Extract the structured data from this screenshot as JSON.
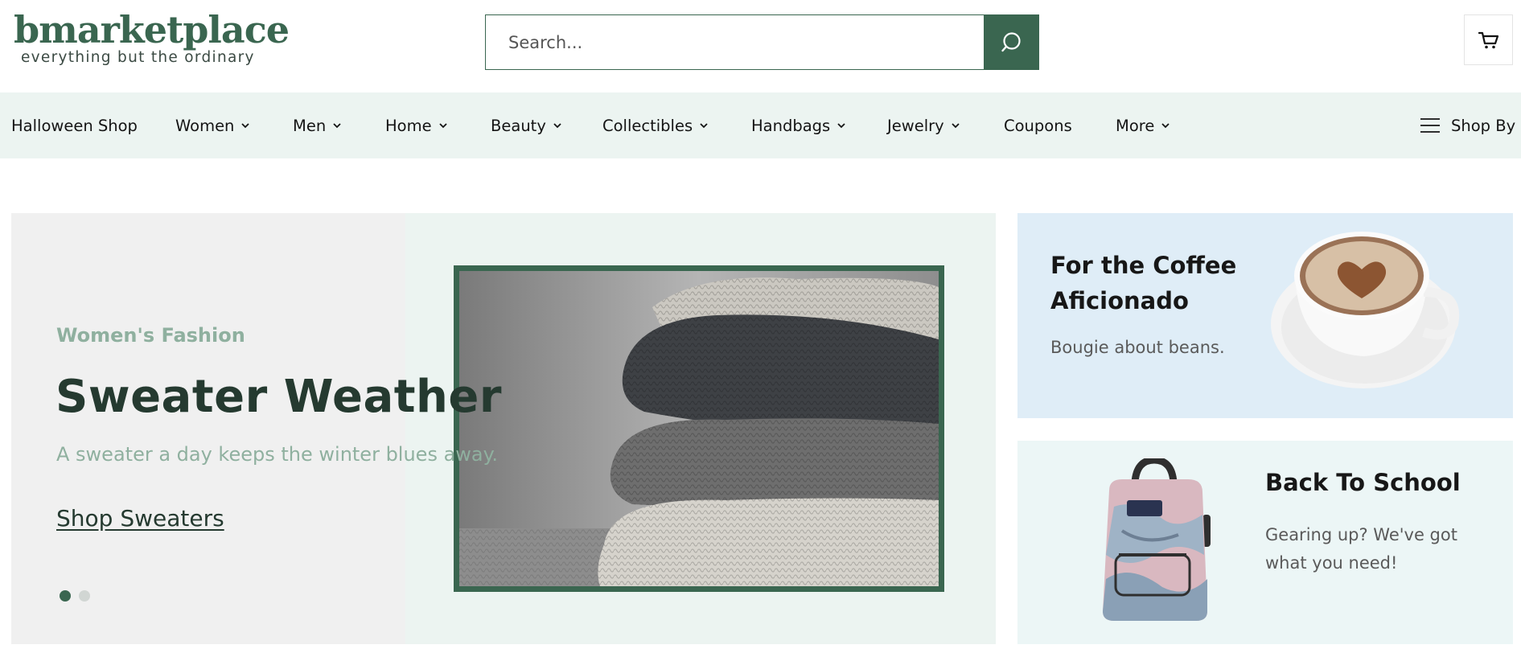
{
  "brand": {
    "name": "bmarketplace",
    "tagline": "everything but the ordinary",
    "accent": "#3a6650"
  },
  "search": {
    "placeholder": "Search...",
    "button_icon": "search-icon"
  },
  "cart": {
    "icon": "cart-icon"
  },
  "nav": {
    "items": [
      {
        "label": "Halloween Shop",
        "dropdown": false
      },
      {
        "label": "Women",
        "dropdown": true
      },
      {
        "label": "Men",
        "dropdown": true
      },
      {
        "label": "Home",
        "dropdown": true
      },
      {
        "label": "Beauty",
        "dropdown": true
      },
      {
        "label": "Collectibles",
        "dropdown": true
      },
      {
        "label": "Handbags",
        "dropdown": true
      },
      {
        "label": "Jewelry",
        "dropdown": true
      },
      {
        "label": "Coupons",
        "dropdown": false
      },
      {
        "label": "More",
        "dropdown": true
      }
    ],
    "shop_by": "Shop By"
  },
  "hero": {
    "kicker": "Women's Fashion",
    "title": "Sweater Weather",
    "subtitle": "A sweater a day keeps the winter blues away.",
    "cta": "Shop Sweaters",
    "slides": 2,
    "active_slide": 1
  },
  "promos": [
    {
      "title_line1": "For the Coffee",
      "title_line2": "Aficionado",
      "subtitle": "Bougie about beans."
    },
    {
      "title": "Back To School",
      "subtitle_line1": "Gearing up? We've got",
      "subtitle_line2": "what you need!"
    }
  ]
}
